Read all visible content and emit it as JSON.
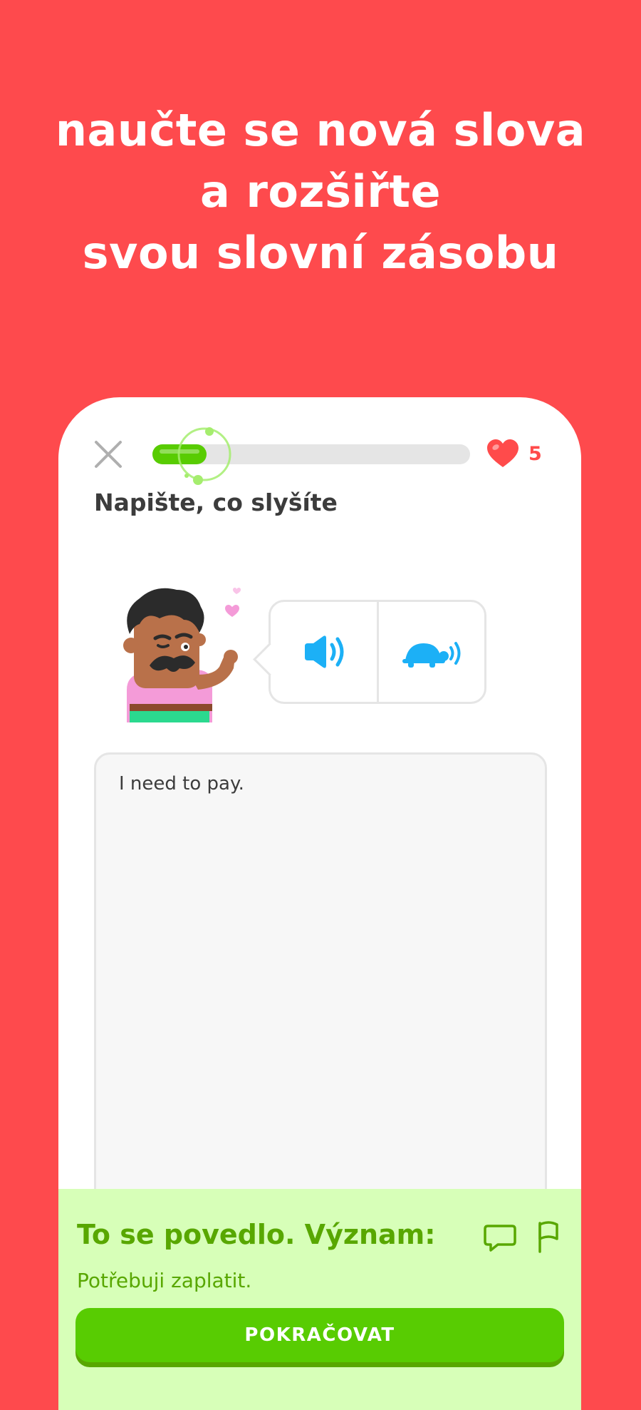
{
  "headline": {
    "line1": "naučte se nová slova",
    "line2": "a rozšiřte",
    "line3": "svou slovní zásobu"
  },
  "lesson": {
    "progress_percent": 17,
    "hearts_count": "5",
    "prompt": "Napište, co slyšíte",
    "audio": {
      "normal_icon": "speaker-icon",
      "slow_icon": "turtle-speaker-icon"
    },
    "answer_text": "I need to pay.",
    "feedback": {
      "title": "To se povedlo. Význam:",
      "meaning": "Potřebuji zaplatit.",
      "continue_label": "POKRAČOVAT"
    }
  },
  "colors": {
    "background": "#fe4a4d",
    "green": "#58cc02",
    "green_dark": "#58a700",
    "feedback_bg": "#d7ffb8",
    "heart": "#ff4b4b",
    "audio_blue": "#1cb0f6"
  }
}
